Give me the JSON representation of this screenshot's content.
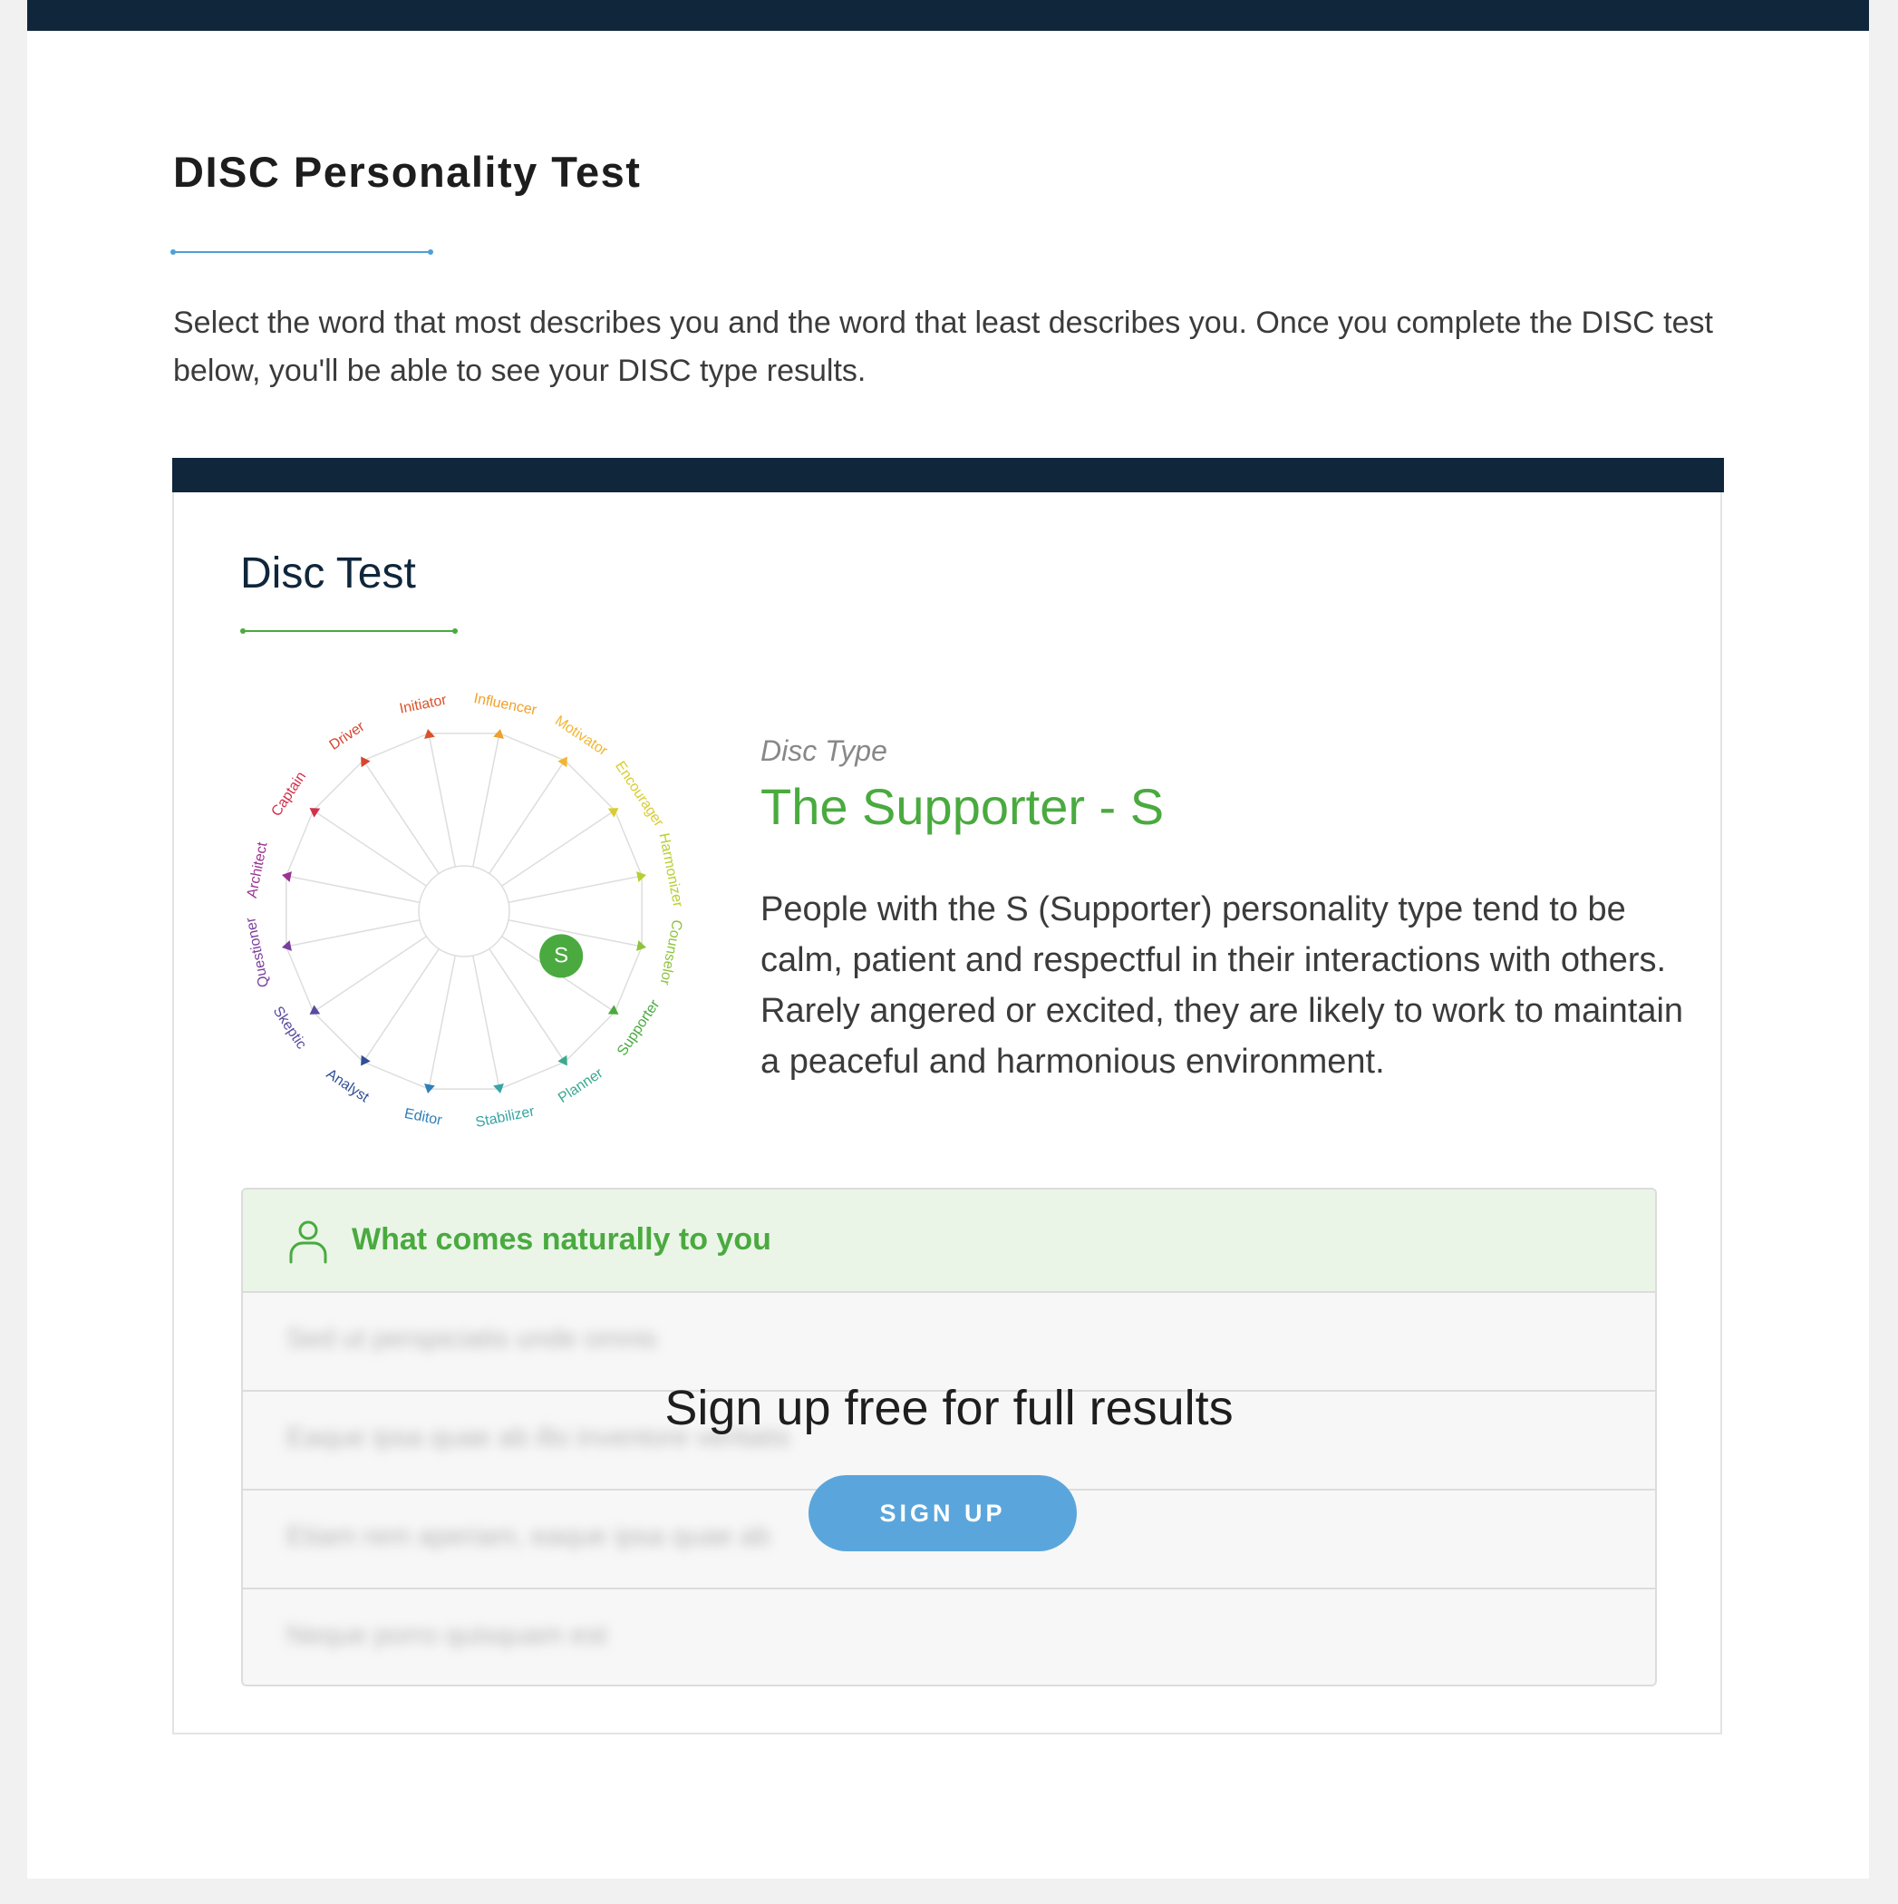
{
  "page": {
    "title": "DISC Personality Test",
    "intro": "Select the word that most describes you and the word that least describes you. Once you complete the DISC test below, you'll be able to see your DISC type results."
  },
  "card": {
    "title": "Disc Test",
    "wheel": {
      "labels": [
        {
          "text": "Initiator",
          "color": "#d9532a"
        },
        {
          "text": "Influencer",
          "color": "#f0a02a"
        },
        {
          "text": "Motivator",
          "color": "#f2b630"
        },
        {
          "text": "Encourager",
          "color": "#d9cc2e"
        },
        {
          "text": "Harmonizer",
          "color": "#b9cf2e"
        },
        {
          "text": "Counselor",
          "color": "#8cc43a"
        },
        {
          "text": "Supporter",
          "color": "#4aaa3f"
        },
        {
          "text": "Planner",
          "color": "#3ba98f"
        },
        {
          "text": "Stabilizer",
          "color": "#37a5a5"
        },
        {
          "text": "Editor",
          "color": "#2f7fba"
        },
        {
          "text": "Analyst",
          "color": "#2f4f96"
        },
        {
          "text": "Skeptic",
          "color": "#5a4aa0"
        },
        {
          "text": "Questioner",
          "color": "#7a3f9e"
        },
        {
          "text": "Architect",
          "color": "#9b3390"
        },
        {
          "text": "Captain",
          "color": "#d0314a"
        },
        {
          "text": "Driver",
          "color": "#d6452f"
        }
      ],
      "marker": {
        "letter": "S",
        "color": "#4aaa3f"
      }
    },
    "disc_type_label": "Disc Type",
    "disc_type_name": "The Supporter - S",
    "description": "People with the S (Supporter) personality type tend to be calm, patient and respectful in their interactions with others. Rarely angered or excited, they are likely to work to maintain a peaceful and harmonious environment."
  },
  "results": {
    "header": "What comes naturally to you",
    "blurred_rows": [
      "Sed ut perspiciatis unde omnis",
      "Eaque ipsa quae ab illo inventore veritatis",
      "Etiam rem aperiam, eaque ipsa quae ab",
      "Neque porro quisquam est"
    ],
    "overlay_text": "Sign up free for full results",
    "signup_label": "SIGN UP"
  },
  "colors": {
    "navy": "#0f263b",
    "green": "#4aaa3f",
    "blue": "#5aa6dc"
  },
  "icons": {
    "results_header": "person-icon"
  }
}
